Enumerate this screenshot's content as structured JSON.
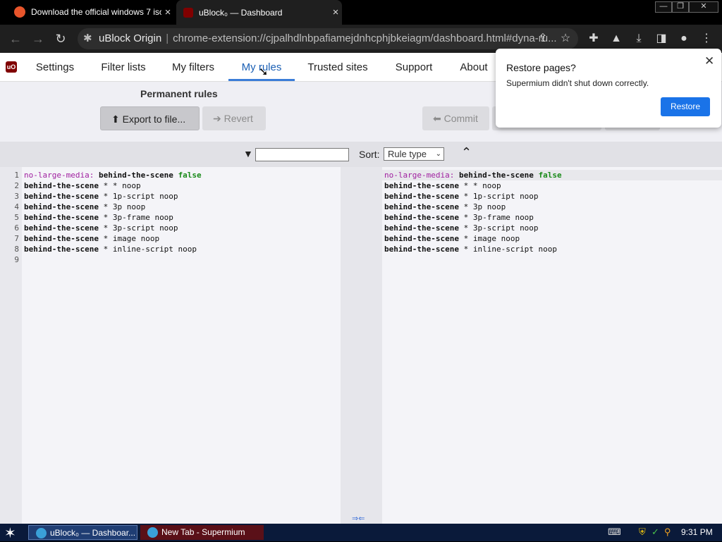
{
  "tabs": [
    {
      "title": "Download the official windows 7 iso",
      "close": "×"
    },
    {
      "title": "uBlock₀ — Dashboard",
      "close": "×"
    }
  ],
  "window_controls": {
    "minimize": "—",
    "restore": "❐",
    "close": "✕"
  },
  "omnibox": {
    "host": "uBlock Origin",
    "separator": "|",
    "url": "chrome-extension://cjpalhdlnbpafiamejdnhcphjbkeiagm/dashboard.html#dyna-ru..."
  },
  "nav": {
    "items": [
      "Settings",
      "Filter lists",
      "My filters",
      "My rules",
      "Trusted sites",
      "Support",
      "About"
    ],
    "active": "My rules"
  },
  "permanent": {
    "label": "Permanent rules",
    "export_label": "Export to file...",
    "revert_label": "Revert"
  },
  "temporary": {
    "commit_label": "Commit"
  },
  "filterbar": {
    "sort_label": "Sort:",
    "sort_value": "Rule type"
  },
  "rules_left": [
    {
      "n": "1",
      "a": "no-large-media:",
      "b": "behind-the-scene",
      "c": "false"
    },
    {
      "n": "2",
      "a": "behind-the-scene",
      "b": "* * noop"
    },
    {
      "n": "3",
      "a": "behind-the-scene",
      "b": "* 1p-script noop"
    },
    {
      "n": "4",
      "a": "behind-the-scene",
      "b": "* 3p noop"
    },
    {
      "n": "5",
      "a": "behind-the-scene",
      "b": "* 3p-frame noop"
    },
    {
      "n": "6",
      "a": "behind-the-scene",
      "b": "* 3p-script noop"
    },
    {
      "n": "7",
      "a": "behind-the-scene",
      "b": "* image noop"
    },
    {
      "n": "8",
      "a": "behind-the-scene",
      "b": "* inline-script noop"
    },
    {
      "n": "9",
      "a": "",
      "b": ""
    }
  ],
  "rules_right": [
    {
      "a": "no-large-media:",
      "b": "behind-the-scene",
      "c": "false"
    },
    {
      "a": "behind-the-scene",
      "b": "* * noop"
    },
    {
      "a": "behind-the-scene",
      "b": "* 1p-script noop"
    },
    {
      "a": "behind-the-scene",
      "b": "* 3p noop"
    },
    {
      "a": "behind-the-scene",
      "b": "* 3p-frame noop"
    },
    {
      "a": "behind-the-scene",
      "b": "* 3p-script noop"
    },
    {
      "a": "behind-the-scene",
      "b": "* image noop"
    },
    {
      "a": "behind-the-scene",
      "b": "* inline-script noop"
    }
  ],
  "merge_arrows": "⇒⇐",
  "popup": {
    "title": "Restore pages?",
    "message": "Supermium didn't shut down correctly.",
    "restore_label": "Restore",
    "close": "✕"
  },
  "taskbar": {
    "tasks": [
      {
        "label": "uBlock₀ — Dashboar..."
      },
      {
        "label": "New Tab - Supermium"
      }
    ],
    "clock": "9:31 PM"
  }
}
